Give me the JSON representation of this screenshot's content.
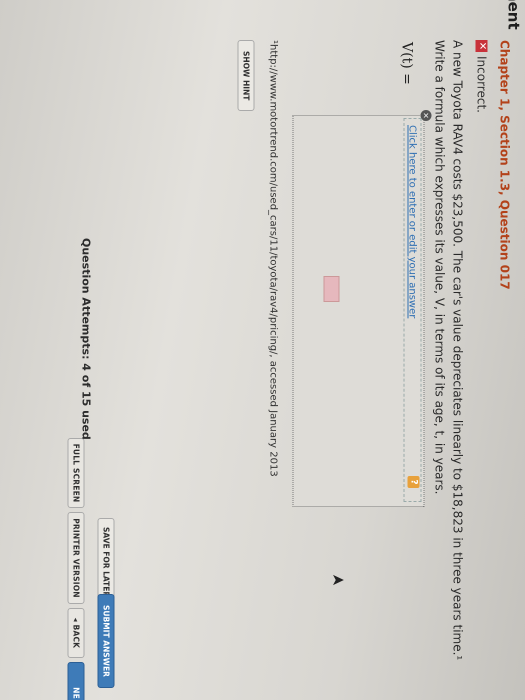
{
  "app": {
    "logo_partial": "ment"
  },
  "toolbar": {
    "full_screen": "FULL SCREEN",
    "printer_version": "PRINTER VERSION",
    "back": "◂ BACK",
    "next_partial": "NE"
  },
  "question": {
    "title": "Chapter 1, Section 1.3, Question 017",
    "status": "Incorrect.",
    "status_icon": "x-icon",
    "text": "A new Toyota RAV4 costs $23,500. The car's value depreciates linearly to $18,823 in three years time.¹ Write a formula which expresses its value, V, in terms of its age, t, in years.",
    "label": "V(t) =",
    "click_here": "Click here to enter or edit your answer",
    "help_glyph": "?",
    "close_glyph": "×",
    "footnote": "¹http://www.motortrend.com/used_cars/11/toyota/rav4/pricing/, accessed January 2013"
  },
  "actions": {
    "show_hint": "SHOW HINT",
    "attempts": "Question Attempts: 4 of 15 used",
    "save_for_later": "SAVE FOR LATER",
    "submit_answer": "SUBMIT ANSWER"
  },
  "colors": {
    "accent": "#3e7bb8",
    "title": "#b3421a",
    "incorrect": "#c8323a"
  }
}
